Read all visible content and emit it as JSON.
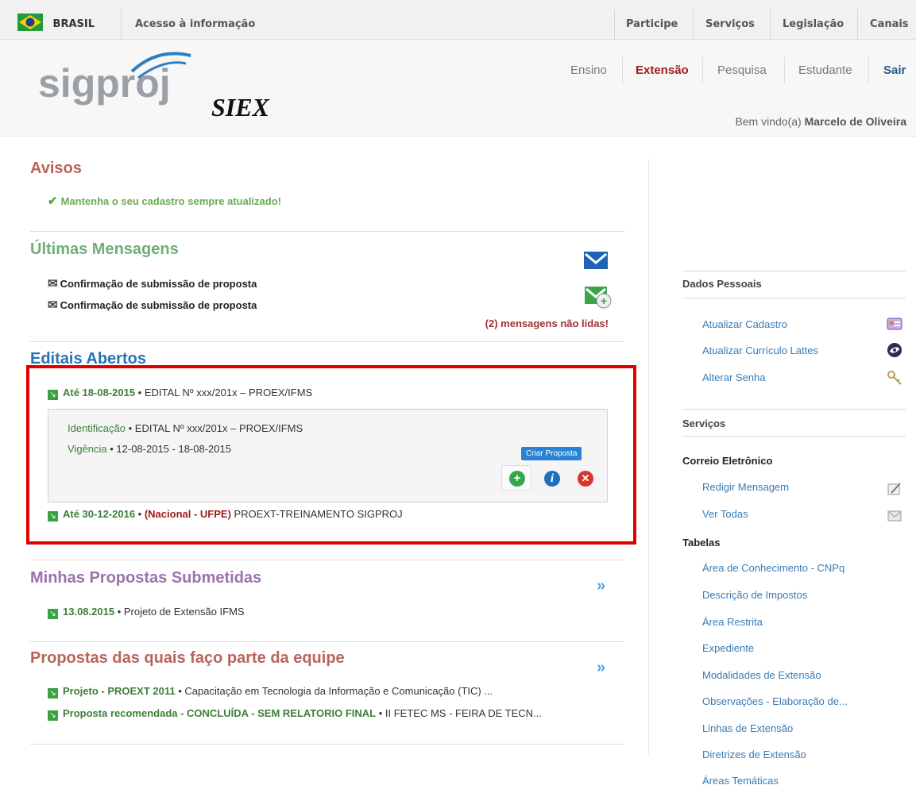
{
  "govbar": {
    "country": "BRASIL",
    "access": "Acesso à informação",
    "links": [
      "Participe",
      "Serviços",
      "Legislação",
      "Canais"
    ]
  },
  "header": {
    "logo_text": "sigproj",
    "logo_sub": "SIEX",
    "nav": [
      "Ensino",
      "Extensão",
      "Pesquisa",
      "Estudante",
      "Sair"
    ],
    "active_nav": "Extensão",
    "welcome_prefix": "Bem vindo(a)",
    "user_name": "Marcelo de Oliveira"
  },
  "avisos": {
    "title": "Avisos",
    "items": [
      "Mantenha o seu cadastro sempre atualizado!"
    ]
  },
  "mensagens": {
    "title": "Últimas Mensagens",
    "items": [
      "Confirmação de submissão de proposta",
      "Confirmação de submissão de proposta"
    ],
    "unread": "(2) mensagens não lidas!"
  },
  "editais": {
    "title": "Editais Abertos",
    "items": [
      {
        "date": "Até 18-08-2015",
        "sep": " • ",
        "text": "EDITAL Nº xxx/201x – PROEX/IFMS"
      },
      {
        "date": "Até 30-12-2016",
        "sep": " • ",
        "tag": "(Nacional - UFPE)",
        "text": "PROEXT-TREINAMENTO SIGPROJ"
      }
    ],
    "detail": {
      "ident_label": "Identificação",
      "ident_value": " • EDITAL Nº xxx/201x – PROEX/IFMS",
      "vig_label": "Vigência",
      "vig_value": " • 12-08-2015 - 18-08-2015",
      "tooltip": "Criar Proposta"
    }
  },
  "submetidas": {
    "title": "Minhas Propostas Submetidas",
    "items": [
      {
        "date": "13.08.2015",
        "text": " • Projeto de Extensão IFMS"
      }
    ]
  },
  "equipe": {
    "title": "Propostas das quais faço parte da equipe",
    "items": [
      {
        "label": "Projeto - PROEXT 2011",
        "text": " • Capacitação em Tecnologia da Informação e Comunicação (TIC) ..."
      },
      {
        "label": "Proposta recomendada - CONCLUÍDA - SEM RELATORIO FINAL",
        "text": " • II FETEC MS - FEIRA DE TECN..."
      }
    ]
  },
  "sidebar": {
    "dados_title": "Dados Pessoais",
    "dados_links": [
      "Atualizar Cadastro",
      "Atualizar Currículo Lattes",
      "Alterar Senha"
    ],
    "servicos_title": "Serviços",
    "correio_title": "Correio Eletrônico",
    "correio_links": [
      "Redigir Mensagem",
      "Ver Todas"
    ],
    "tabelas_title": "Tabelas",
    "tabelas_links": [
      "Área de Conhecimento - CNPq",
      "Descrição de Impostos",
      "Área Restrita",
      "Expediente",
      "Modalidades de Extensão",
      "Observações - Elaboração de...",
      "Linhas de Extensão",
      "Diretrizes de Extensão",
      "Áreas Temáticas"
    ]
  },
  "colors": {
    "avisos": "#b9645b",
    "mensagens": "#6fae7a",
    "editais": "#2673b8",
    "submetidas": "#9c71ae",
    "highlight_border": "#e00000"
  }
}
